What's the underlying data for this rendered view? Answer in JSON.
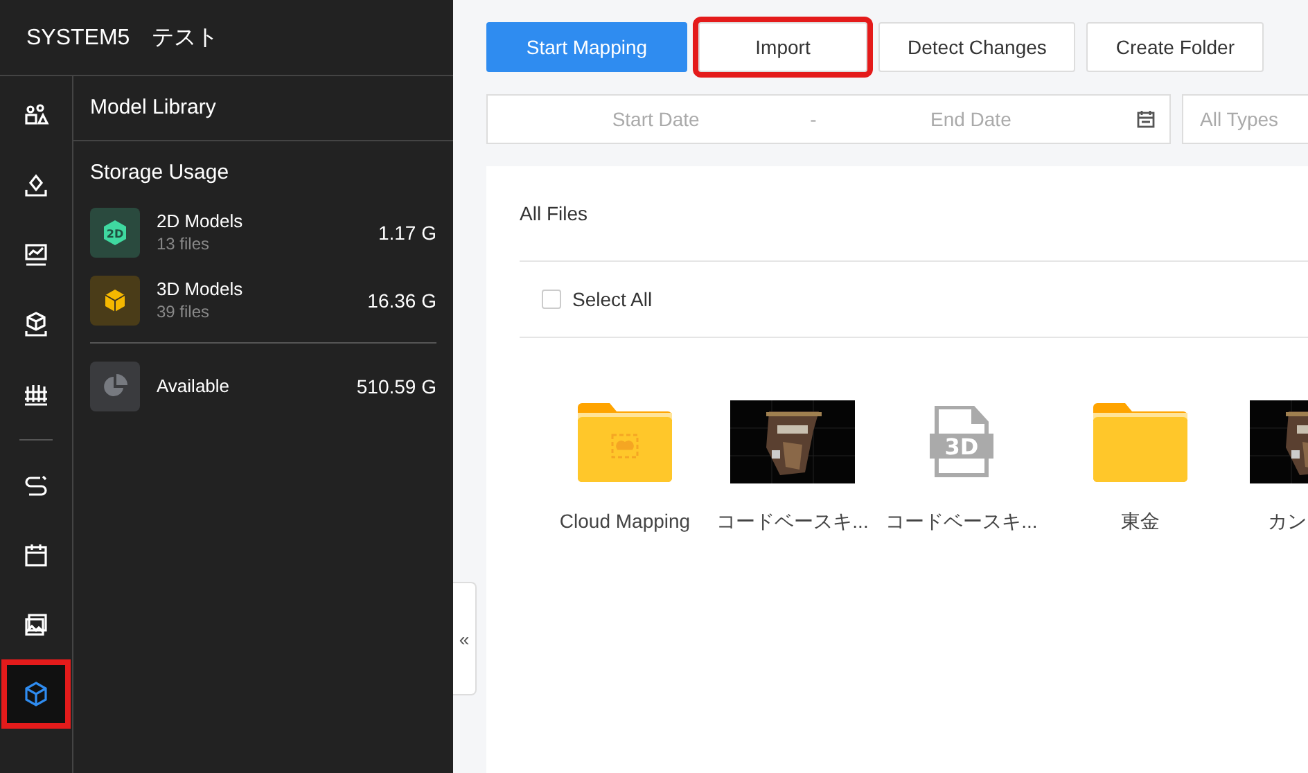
{
  "app_title": "SYSTEM5　テスト",
  "nav": [
    {
      "selected": false,
      "highlighted": false
    },
    {
      "selected": false,
      "highlighted": false
    },
    {
      "selected": false,
      "highlighted": false
    },
    {
      "selected": false,
      "highlighted": false
    },
    {
      "selected": false,
      "highlighted": false
    },
    {
      "selected": false,
      "highlighted": false
    },
    {
      "selected": false,
      "highlighted": false
    },
    {
      "selected": false,
      "highlighted": false
    },
    {
      "selected": true,
      "highlighted": true
    }
  ],
  "panel": {
    "title": "Model Library",
    "storage_title": "Storage Usage",
    "storage": [
      {
        "kind": "flat",
        "badge": "2D",
        "name": "2D Models",
        "files": "13 files",
        "size": "1.17 G"
      },
      {
        "kind": "solid",
        "name": "3D Models",
        "files": "39 files",
        "size": "16.36 G"
      },
      {
        "kind": "available",
        "name": "Available",
        "size": "510.59 G"
      }
    ]
  },
  "collapse": "«",
  "toolbar": [
    {
      "label": "Start Mapping",
      "primary": true,
      "highlighted": false
    },
    {
      "label": "Import",
      "primary": false,
      "highlighted": true
    },
    {
      "label": "Detect Changes",
      "primary": false,
      "highlighted": false
    },
    {
      "label": "Create Folder",
      "primary": false,
      "highlighted": false
    }
  ],
  "filters": {
    "start_placeholder": "Start Date",
    "separator": "-",
    "end_placeholder": "End Date",
    "type_placeholder": "All Types"
  },
  "files": {
    "breadcrumb": "All Files",
    "select_all": "Select All",
    "select_all_checked": false,
    "items": [
      {
        "kind": "cloud-folder",
        "name": "Cloud Mapping"
      },
      {
        "kind": "picture",
        "name": "コードベースキ..."
      },
      {
        "kind": "model3d",
        "badge": "3D",
        "name": "コードベースキ..."
      },
      {
        "kind": "folder",
        "name": "東金"
      },
      {
        "kind": "picture",
        "name": "カン"
      }
    ]
  }
}
